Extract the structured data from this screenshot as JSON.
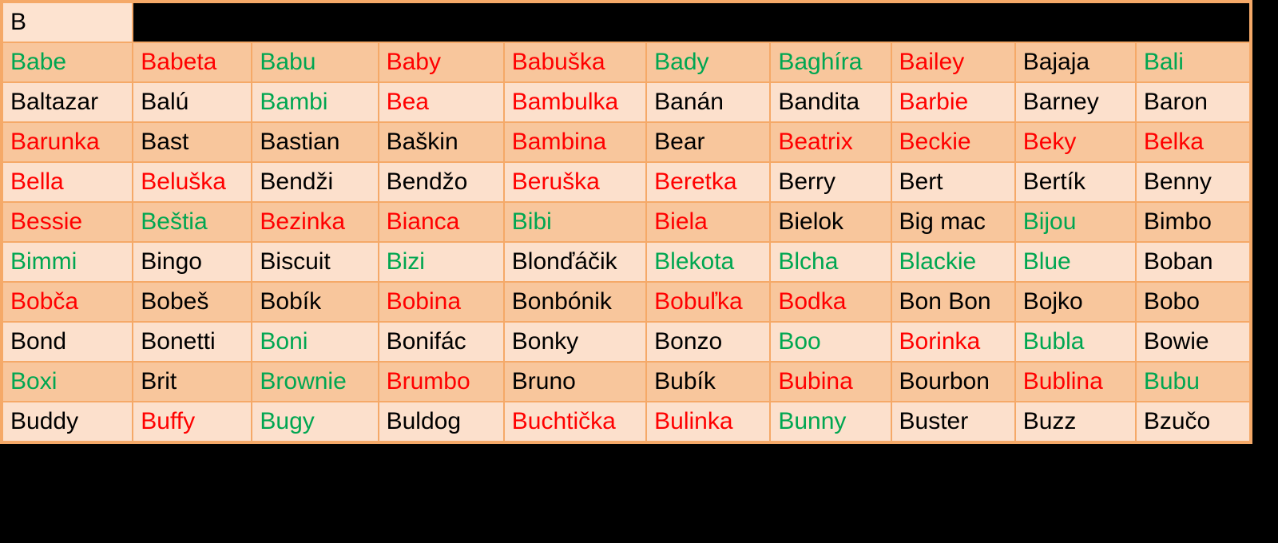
{
  "table": {
    "header_label": "B",
    "colors": {
      "text_black": "#000000",
      "text_red": "#FF0000",
      "text_green": "#00A651",
      "row_dark_bg": "#F8C69C",
      "row_light_bg": "#FCE0CC",
      "header_bg": "#FDE3D0",
      "grid_border": "#F5A968",
      "page_bg": "#000000"
    },
    "columns": 10,
    "rows": [
      {
        "shade": "dark",
        "cells": [
          {
            "text": "Babe",
            "color": "green"
          },
          {
            "text": "Babeta",
            "color": "red"
          },
          {
            "text": "Babu",
            "color": "green"
          },
          {
            "text": "Baby",
            "color": "red"
          },
          {
            "text": "Babuška",
            "color": "red"
          },
          {
            "text": "Bady",
            "color": "green"
          },
          {
            "text": "Baghíra",
            "color": "green"
          },
          {
            "text": "Bailey",
            "color": "red"
          },
          {
            "text": "Bajaja",
            "color": "black"
          },
          {
            "text": "Bali",
            "color": "green"
          }
        ]
      },
      {
        "shade": "light",
        "cells": [
          {
            "text": "Baltazar",
            "color": "black"
          },
          {
            "text": "Balú",
            "color": "black"
          },
          {
            "text": "Bambi",
            "color": "green"
          },
          {
            "text": "Bea",
            "color": "red"
          },
          {
            "text": "Bambulka",
            "color": "red"
          },
          {
            "text": "Banán",
            "color": "black"
          },
          {
            "text": "Bandita",
            "color": "black"
          },
          {
            "text": "Barbie",
            "color": "red"
          },
          {
            "text": "Barney",
            "color": "black"
          },
          {
            "text": "Baron",
            "color": "black"
          }
        ]
      },
      {
        "shade": "dark",
        "cells": [
          {
            "text": "Barunka",
            "color": "red"
          },
          {
            "text": "Bast",
            "color": "black"
          },
          {
            "text": "Bastian",
            "color": "black"
          },
          {
            "text": "Baškin",
            "color": "black"
          },
          {
            "text": "Bambina",
            "color": "red"
          },
          {
            "text": "Bear",
            "color": "black"
          },
          {
            "text": "Beatrix",
            "color": "red"
          },
          {
            "text": "Beckie",
            "color": "red"
          },
          {
            "text": "Beky",
            "color": "red"
          },
          {
            "text": "Belka",
            "color": "red"
          }
        ]
      },
      {
        "shade": "light",
        "cells": [
          {
            "text": "Bella",
            "color": "red"
          },
          {
            "text": "Beluška",
            "color": "red"
          },
          {
            "text": "Bendži",
            "color": "black"
          },
          {
            "text": "Bendžo",
            "color": "black"
          },
          {
            "text": "Beruška",
            "color": "red"
          },
          {
            "text": "Beretka",
            "color": "red"
          },
          {
            "text": "Berry",
            "color": "black"
          },
          {
            "text": "Bert",
            "color": "black"
          },
          {
            "text": "Bertík",
            "color": "black"
          },
          {
            "text": "Benny",
            "color": "black"
          }
        ]
      },
      {
        "shade": "dark",
        "cells": [
          {
            "text": "Bessie",
            "color": "red"
          },
          {
            "text": "Beštia",
            "color": "green"
          },
          {
            "text": "Bezinka",
            "color": "red"
          },
          {
            "text": "Bianca",
            "color": "red"
          },
          {
            "text": "Bibi",
            "color": "green"
          },
          {
            "text": "Biela",
            "color": "red"
          },
          {
            "text": "Bielok",
            "color": "black"
          },
          {
            "text": "Big mac",
            "color": "black"
          },
          {
            "text": "Bijou",
            "color": "green"
          },
          {
            "text": "Bimbo",
            "color": "black"
          }
        ]
      },
      {
        "shade": "light",
        "cells": [
          {
            "text": "Bimmi",
            "color": "green"
          },
          {
            "text": "Bingo",
            "color": "black"
          },
          {
            "text": "Biscuit",
            "color": "black"
          },
          {
            "text": "Bizi",
            "color": "green"
          },
          {
            "text": "Blonďáčik",
            "color": "black"
          },
          {
            "text": "Blekota",
            "color": "green"
          },
          {
            "text": "Blcha",
            "color": "green"
          },
          {
            "text": "Blackie",
            "color": "green"
          },
          {
            "text": "Blue",
            "color": "green"
          },
          {
            "text": "Boban",
            "color": "black"
          }
        ]
      },
      {
        "shade": "dark",
        "cells": [
          {
            "text": "Bobča",
            "color": "red"
          },
          {
            "text": "Bobeš",
            "color": "black"
          },
          {
            "text": "Bobík",
            "color": "black"
          },
          {
            "text": "Bobina",
            "color": "red"
          },
          {
            "text": "Bonbónik",
            "color": "black"
          },
          {
            "text": "Bobuľka",
            "color": "red"
          },
          {
            "text": "Bodka",
            "color": "red"
          },
          {
            "text": "Bon Bon",
            "color": "black"
          },
          {
            "text": "Bojko",
            "color": "black"
          },
          {
            "text": "Bobo",
            "color": "black"
          }
        ]
      },
      {
        "shade": "light",
        "cells": [
          {
            "text": "Bond",
            "color": "black"
          },
          {
            "text": "Bonetti",
            "color": "black"
          },
          {
            "text": "Boni",
            "color": "green"
          },
          {
            "text": "Bonifác",
            "color": "black"
          },
          {
            "text": "Bonky",
            "color": "black"
          },
          {
            "text": "Bonzo",
            "color": "black"
          },
          {
            "text": "Boo",
            "color": "green"
          },
          {
            "text": "Borinka",
            "color": "red"
          },
          {
            "text": "Bubla",
            "color": "green"
          },
          {
            "text": "Bowie",
            "color": "black"
          }
        ]
      },
      {
        "shade": "dark",
        "cells": [
          {
            "text": "Boxi",
            "color": "green"
          },
          {
            "text": "Brit",
            "color": "black"
          },
          {
            "text": "Brownie",
            "color": "green"
          },
          {
            "text": "Brumbo",
            "color": "red"
          },
          {
            "text": "Bruno",
            "color": "black"
          },
          {
            "text": "Bubík",
            "color": "black"
          },
          {
            "text": "Bubina",
            "color": "red"
          },
          {
            "text": "Bourbon",
            "color": "black"
          },
          {
            "text": "Bublina",
            "color": "red"
          },
          {
            "text": "Bubu",
            "color": "green"
          }
        ]
      },
      {
        "shade": "light",
        "cells": [
          {
            "text": "Buddy",
            "color": "black"
          },
          {
            "text": "Buffy",
            "color": "red"
          },
          {
            "text": "Bugy",
            "color": "green"
          },
          {
            "text": "Buldog",
            "color": "black"
          },
          {
            "text": "Buchtička",
            "color": "red"
          },
          {
            "text": "Bulinka",
            "color": "red"
          },
          {
            "text": "Bunny",
            "color": "green"
          },
          {
            "text": "Buster",
            "color": "black"
          },
          {
            "text": "Buzz",
            "color": "black"
          },
          {
            "text": "Bzučo",
            "color": "black"
          }
        ]
      }
    ]
  }
}
